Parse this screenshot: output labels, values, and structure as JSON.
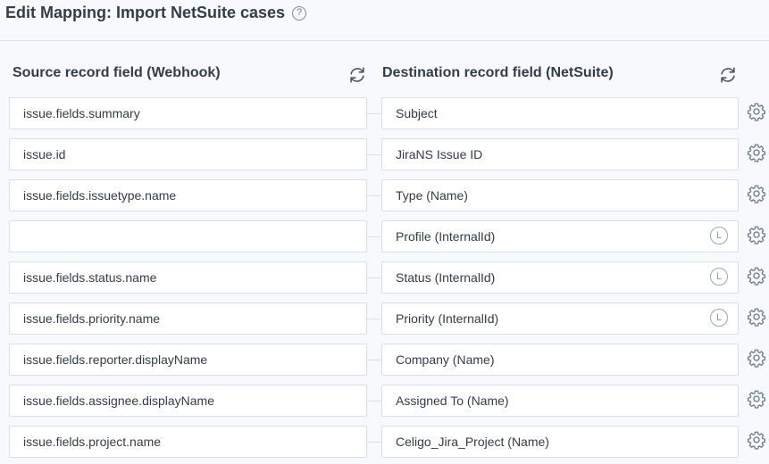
{
  "header": {
    "title": "Edit Mapping: Import NetSuite cases",
    "help_icon": "help-circle-icon",
    "help_glyph": "?"
  },
  "columns": {
    "source": {
      "label": "Source record field (Webhook)",
      "refresh_icon": "refresh-icon"
    },
    "destination": {
      "label": "Destination record field (NetSuite)",
      "refresh_icon": "refresh-icon"
    }
  },
  "rows": [
    {
      "source": "issue.fields.summary",
      "destination": "Subject",
      "lookup": false
    },
    {
      "source": "issue.id",
      "destination": "JiraNS Issue ID",
      "lookup": false
    },
    {
      "source": "issue.fields.issuetype.name",
      "destination": "Type (Name)",
      "lookup": false
    },
    {
      "source": "",
      "destination": "Profile (InternalId)",
      "lookup": true
    },
    {
      "source": "issue.fields.status.name",
      "destination": "Status (InternalId)",
      "lookup": true
    },
    {
      "source": "issue.fields.priority.name",
      "destination": "Priority (InternalId)",
      "lookup": true
    },
    {
      "source": "issue.fields.reporter.displayName",
      "destination": "Company (Name)",
      "lookup": false
    },
    {
      "source": "issue.fields.assignee.displayName",
      "destination": "Assigned To (Name)",
      "lookup": false
    },
    {
      "source": "issue.fields.project.name",
      "destination": "Celigo_Jira_Project (Name)",
      "lookup": false
    }
  ],
  "lookup_glyph": "L",
  "settings_icon": "gear-icon",
  "colors": {
    "background": "#f7f9fc",
    "border": "#d6e0ea",
    "text": "#333d47",
    "icon": "#6a7a89"
  }
}
